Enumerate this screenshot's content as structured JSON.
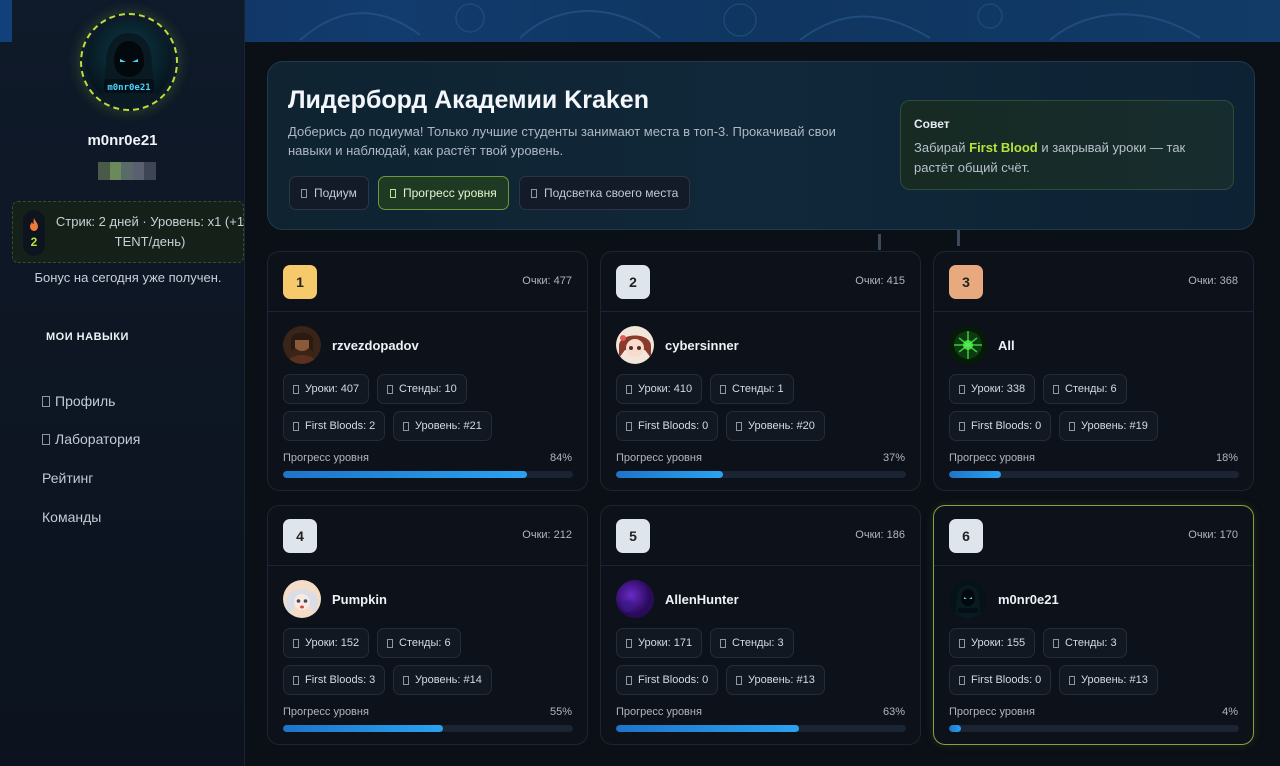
{
  "sidebar": {
    "username": "m0nr0e21",
    "avatar_tag": "m0nr0e21",
    "streak_count": "2",
    "streak_text": "Стрик: 2 дней · Уровень: x1 (+1 TENT/день)",
    "bonus_text": "Бонус на сегодня уже получен.",
    "skills_title": "МОИ НАВЫКИ",
    "nav": [
      {
        "label": "Профиль",
        "icon": "user-icon"
      },
      {
        "label": "Лаборатория",
        "icon": "flask-icon"
      },
      {
        "label": "Рейтинг",
        "icon": ""
      },
      {
        "label": "Команды",
        "icon": ""
      }
    ]
  },
  "header": {
    "title": "Лидерборд Академии Kraken",
    "subtitle": "Доберись до подиума! Только лучшие студенты занимают места в топ-3. Прокачивай свои навыки и наблюдай, как растёт твой уровень.",
    "pills": [
      {
        "label": "Подиум",
        "active": false
      },
      {
        "label": "Прогресс уровня",
        "active": true
      },
      {
        "label": "Подсветка своего места",
        "active": false
      }
    ],
    "tip": {
      "title": "Совет",
      "prefix": "Забирай ",
      "highlight": "First Blood",
      "suffix": " и закрывай уроки — так растёт общий счёт."
    }
  },
  "cards": [
    {
      "rank": "1",
      "points": "Очки: 477",
      "name": "rzvezdopadov",
      "lessons": "Уроки: 407",
      "stands": "Стенды: 10",
      "first_bloods": "First Bloods: 2",
      "level": "Уровень: #21",
      "progress_label": "Прогресс уровня",
      "progress_text": "84%",
      "progress": 0.84,
      "rank_color": "#f6c96a",
      "avatar": "avatar-portrait"
    },
    {
      "rank": "2",
      "points": "Очки: 415",
      "name": "cybersinner",
      "lessons": "Уроки: 410",
      "stands": "Стенды: 1",
      "first_bloods": "First Bloods: 0",
      "level": "Уровень: #20",
      "progress_label": "Прогресс уровня",
      "progress_text": "37%",
      "progress": 0.37,
      "rank_color": "#dfe5ec",
      "avatar": "avatar-anime"
    },
    {
      "rank": "3",
      "points": "Очки: 368",
      "name": "All",
      "lessons": "Уроки: 338",
      "stands": "Стенды: 6",
      "first_bloods": "First Bloods: 0",
      "level": "Уровень: #19",
      "progress_label": "Прогресс уровня",
      "progress_text": "18%",
      "progress": 0.18,
      "rank_color": "#e9a97e",
      "avatar": "avatar-green"
    },
    {
      "rank": "4",
      "points": "Очки: 212",
      "name": "Pumpkin",
      "lessons": "Уроки: 152",
      "stands": "Стенды: 6",
      "first_bloods": "First Bloods: 3",
      "level": "Уровень: #14",
      "progress_label": "Прогресс уровня",
      "progress_text": "55%",
      "progress": 0.55,
      "rank_color": "#dfe5ec",
      "avatar": "avatar-anime2"
    },
    {
      "rank": "5",
      "points": "Очки: 186",
      "name": "AllenHunter",
      "lessons": "Уроки: 171",
      "stands": "Стенды: 3",
      "first_bloods": "First Bloods: 0",
      "level": "Уровень: #13",
      "progress_label": "Прогресс уровня",
      "progress_text": "63%",
      "progress": 0.63,
      "rank_color": "#dfe5ec",
      "avatar": "avatar-purple"
    },
    {
      "rank": "6",
      "points": "Очки: 170",
      "name": "m0nr0e21",
      "lessons": "Уроки: 155",
      "stands": "Стенды: 3",
      "first_bloods": "First Bloods: 0",
      "level": "Уровень: #13",
      "progress_label": "Прогресс уровня",
      "progress_text": "4%",
      "progress": 0.04,
      "rank_color": "#dfe5ec",
      "avatar": "avatar-hacker"
    }
  ],
  "colors": {
    "accent_green": "#b8e23c",
    "progress_blue": "#2aa2f0",
    "background": "#0b0f16"
  }
}
